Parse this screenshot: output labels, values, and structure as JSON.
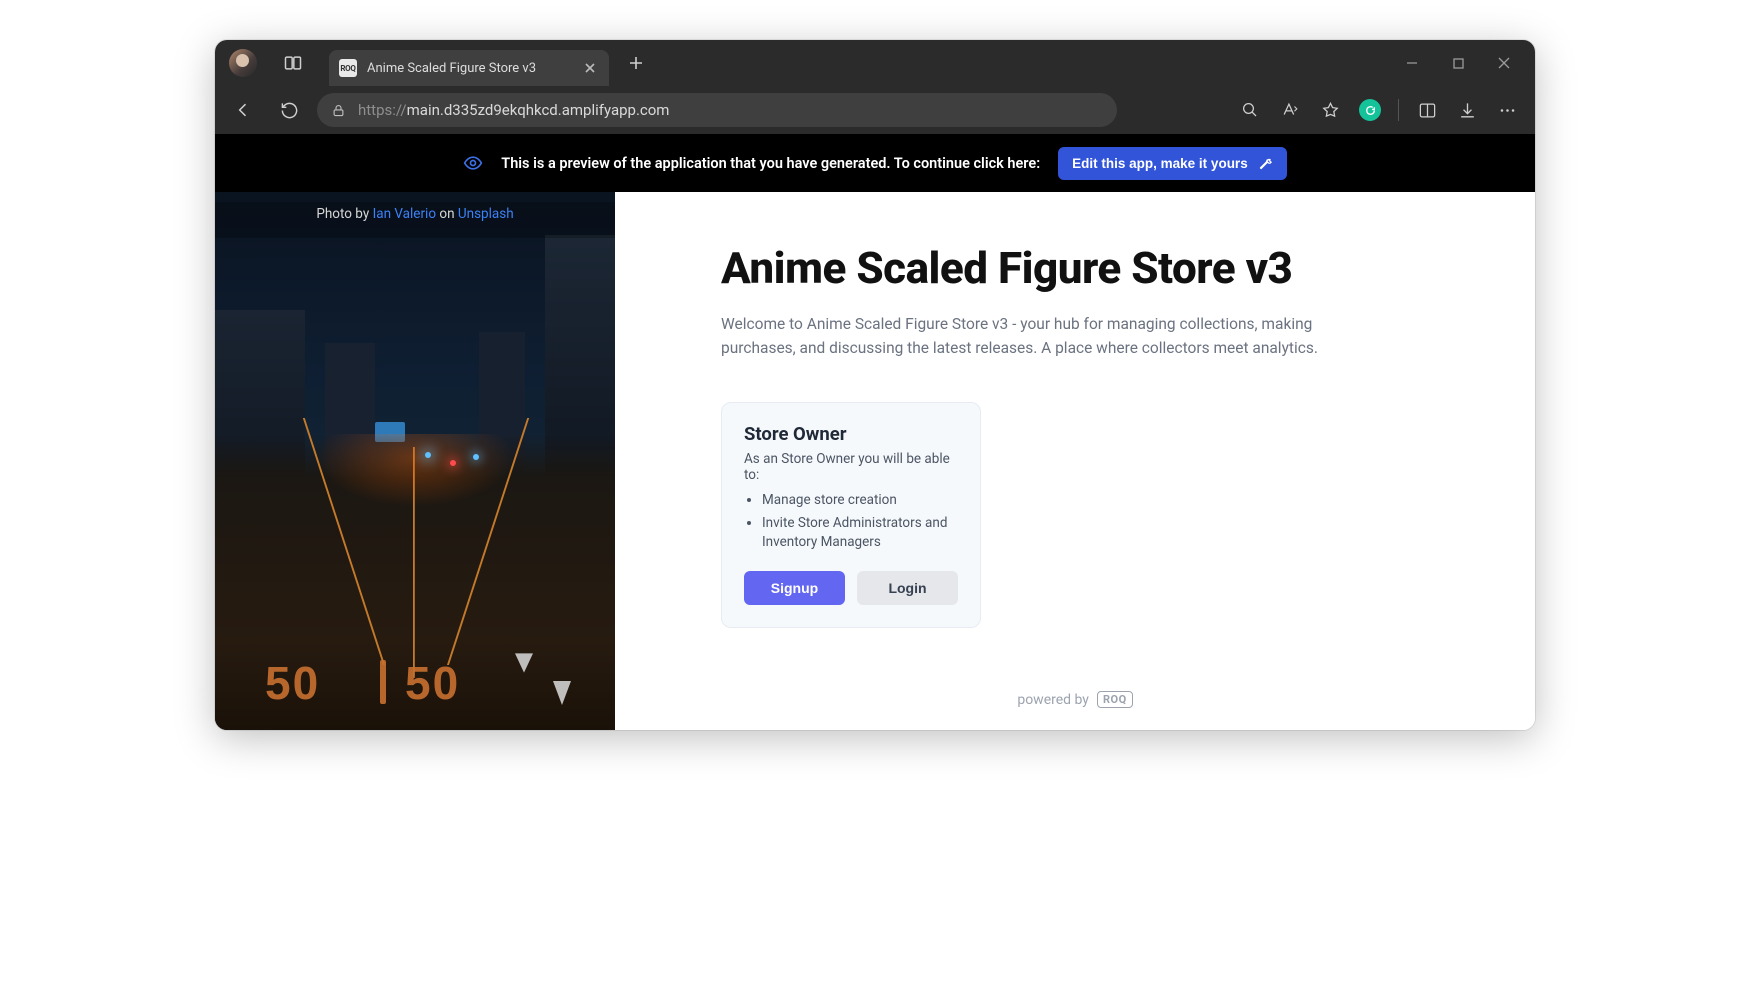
{
  "browser": {
    "tab_title": "Anime Scaled Figure Store v3",
    "url_protocol": "https://",
    "url_rest": "main.d335zd9ekqhkcd.amplifyapp.com"
  },
  "banner": {
    "text": "This is a preview of the application that you have generated. To continue click here:",
    "button": "Edit this app, make it yours"
  },
  "hero": {
    "credit_prefix": "Photo by ",
    "credit_author": "Ian Valerio",
    "credit_middle": " on ",
    "credit_source": "Unsplash",
    "road_left": "50",
    "road_right": "50"
  },
  "main": {
    "title": "Anime Scaled Figure Store v3",
    "subtitle": "Welcome to Anime Scaled Figure Store v3 - your hub for managing collections, making purchases, and discussing the latest releases. A place where collectors meet analytics."
  },
  "card": {
    "title": "Store Owner",
    "subtitle": "As an Store Owner you will be able to:",
    "bullets": [
      "Manage store creation",
      "Invite Store Administrators and Inventory Managers"
    ],
    "signup": "Signup",
    "login": "Login"
  },
  "footer": {
    "powered_by": "powered by",
    "brand": "ROQ"
  }
}
